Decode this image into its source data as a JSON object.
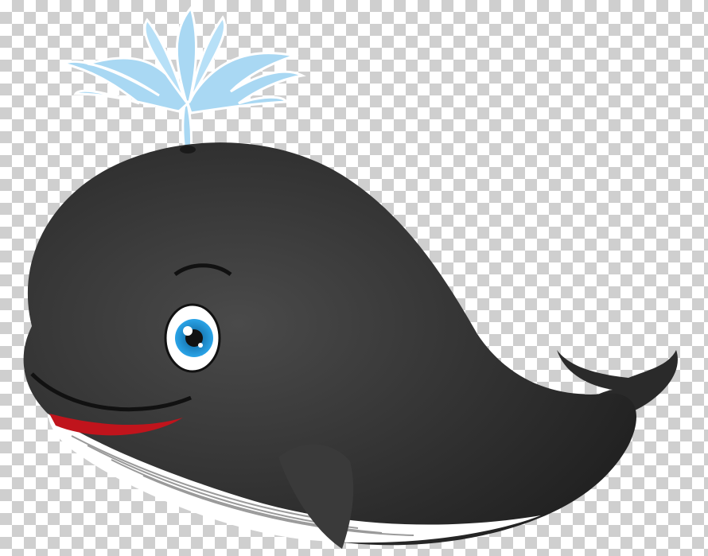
{
  "subject": "cartoon-whale-with-water-spout",
  "background": "transparency-checkerboard",
  "colors": {
    "body": "#2a2a2a",
    "body_highlight": "#4a4a4a",
    "belly": "#ffffff",
    "belly_stripes": "#9a9a9a",
    "mouth": "#c0141c",
    "eye_iris": "#1b8fd2",
    "water": "#a9d8f3",
    "water_outline": "#ffffff",
    "checker_light": "#ffffff",
    "checker_dark": "#cfcfcf"
  }
}
